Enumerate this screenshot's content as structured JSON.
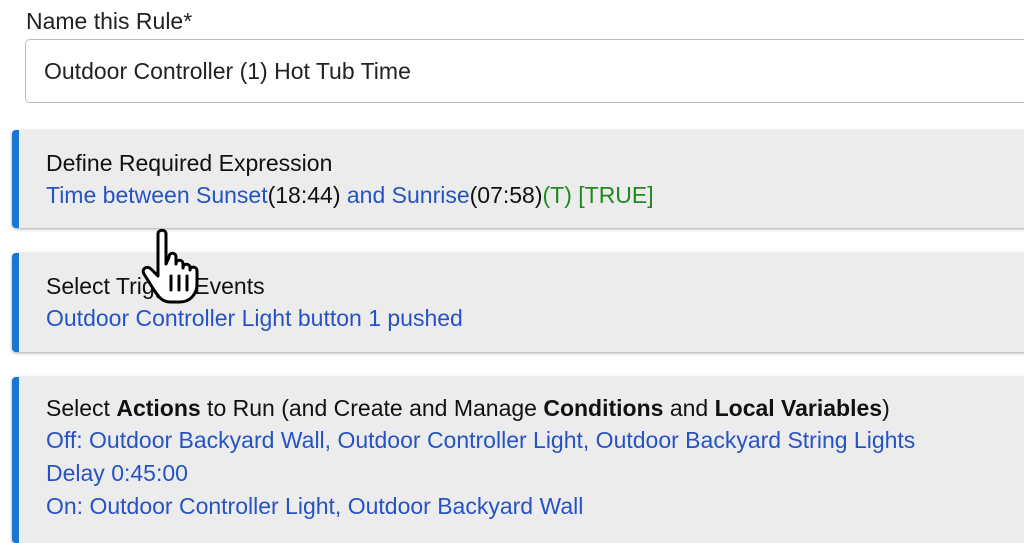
{
  "rule_name": {
    "label": "Name this Rule*",
    "value": "Outdoor Controller (1) Hot Tub Time"
  },
  "required_expression": {
    "title": "Define Required Expression",
    "parts": {
      "time_between_sunset": "Time between Sunset",
      "sunset_time": "(18:44)",
      "and_sunrise": " and Sunrise",
      "sunrise_time": "(07:58)",
      "status": "(T) [TRUE]"
    }
  },
  "trigger_events": {
    "title": "Select Trigger Events",
    "value": "Outdoor Controller Light button 1 pushed"
  },
  "actions": {
    "title": {
      "t1": "Select ",
      "b1": "Actions",
      "t2": " to Run (and Create and Manage ",
      "b2": "Conditions",
      "t3": " and ",
      "b3": "Local Variables",
      "t4": ")"
    },
    "lines": {
      "off": "Off: Outdoor Backyard Wall, Outdoor Controller Light, Outdoor Backyard String Lights",
      "delay": "Delay 0:45:00",
      "on": "On: Outdoor Controller Light, Outdoor Backyard Wall"
    }
  },
  "cursor": {
    "icon": "hand-pointer-icon"
  },
  "colors": {
    "accent": "#1976d2",
    "link": "#2653c4",
    "true_status": "#1f8a1f",
    "panel_bg": "#ececec"
  }
}
